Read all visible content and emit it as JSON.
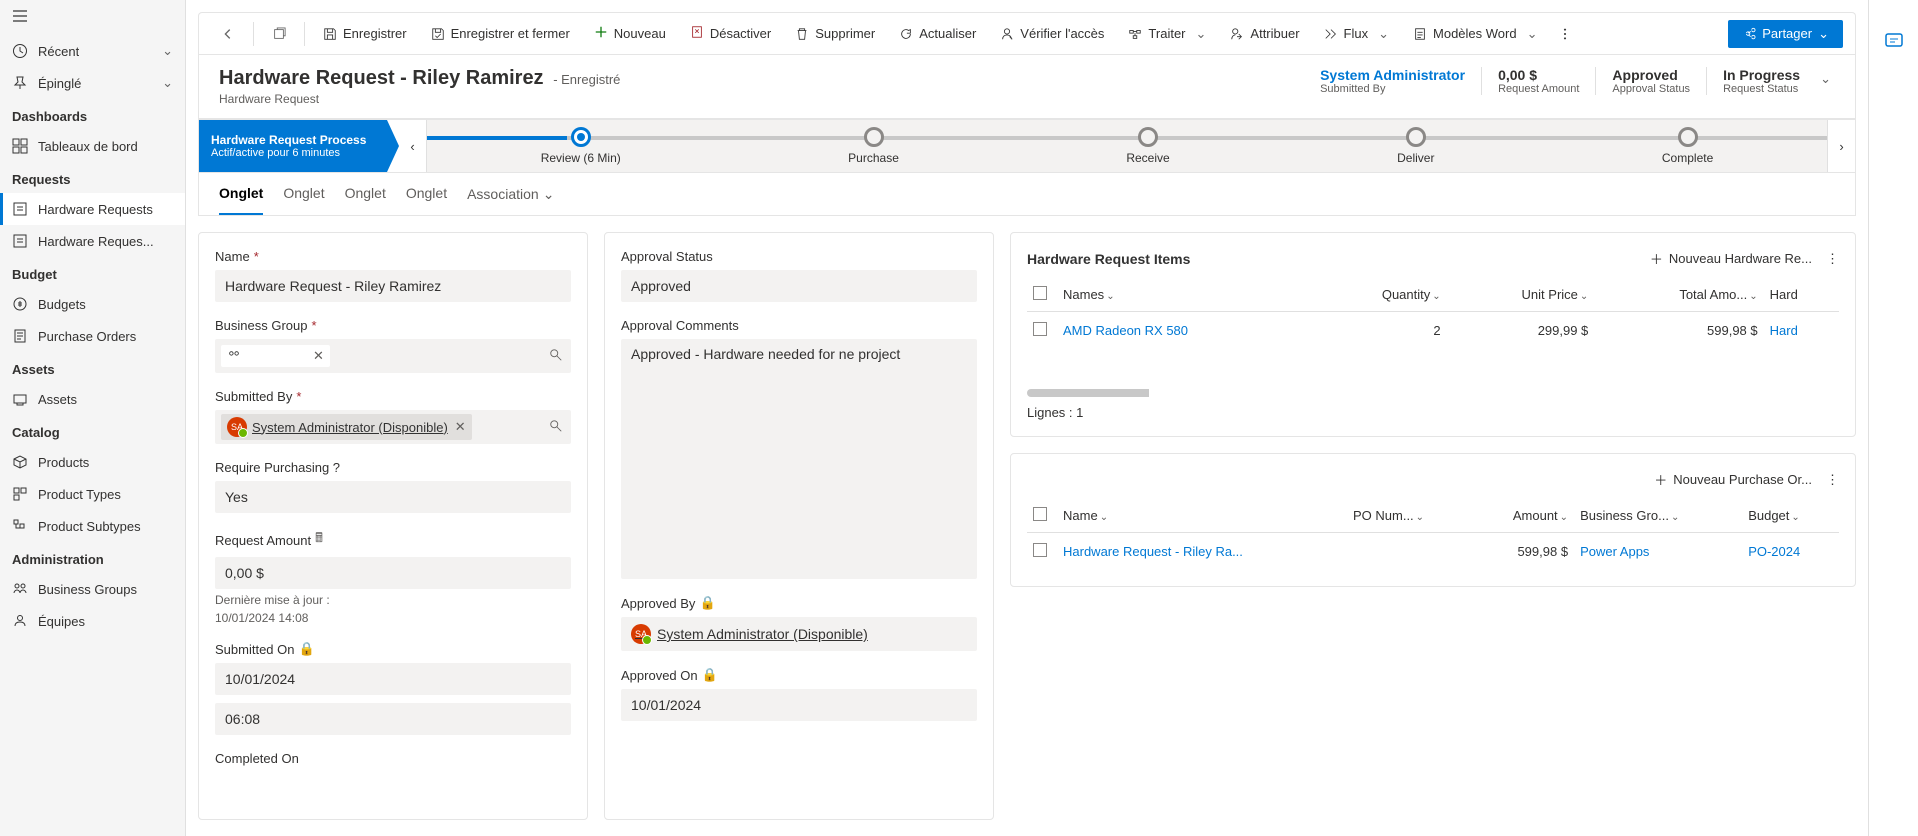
{
  "sidebar": {
    "recent": "Récent",
    "pinned": "Épinglé",
    "sections": {
      "dashboards": "Dashboards",
      "dash_item": "Tableaux de bord",
      "requests": "Requests",
      "req1": "Hardware Requests",
      "req2": "Hardware Reques...",
      "budget": "Budget",
      "budgets": "Budgets",
      "po": "Purchase Orders",
      "assets": "Assets",
      "assets_item": "Assets",
      "catalog": "Catalog",
      "products": "Products",
      "ptypes": "Product Types",
      "psubtypes": "Product Subtypes",
      "admin": "Administration",
      "bg": "Business Groups",
      "teams": "Équipes"
    }
  },
  "commands": {
    "save": "Enregistrer",
    "saveclose": "Enregistrer et fermer",
    "new": "Nouveau",
    "deactivate": "Désactiver",
    "delete": "Supprimer",
    "refresh": "Actualiser",
    "checkaccess": "Vérifier l'accès",
    "process": "Traiter",
    "assign": "Attribuer",
    "flow": "Flux",
    "wordtmpl": "Modèles Word",
    "share": "Partager"
  },
  "header": {
    "title": "Hardware Request - Riley Ramirez",
    "status": "- Enregistré",
    "subtitle": "Hardware Request",
    "fields": [
      {
        "val": "System Administrator",
        "lbl": "Submitted By",
        "link": true
      },
      {
        "val": "0,00 $",
        "lbl": "Request Amount"
      },
      {
        "val": "Approved",
        "lbl": "Approval Status"
      },
      {
        "val": "In Progress",
        "lbl": "Request Status"
      }
    ]
  },
  "bpf": {
    "title": "Hardware Request Process",
    "sub": "Actif/active pour 6 minutes",
    "stages": [
      "Review  (6 Min)",
      "Purchase",
      "Receive",
      "Deliver",
      "Complete"
    ]
  },
  "tabs": [
    "Onglet",
    "Onglet",
    "Onglet",
    "Onglet",
    "Association"
  ],
  "form": {
    "name_lbl": "Name",
    "name_val": "Hardware Request - Riley Ramirez",
    "bg_lbl": "Business Group",
    "subby_lbl": "Submitted By",
    "subby_val": "System Administrator (Disponible)",
    "reqpur_lbl": "Require Purchasing ?",
    "reqpur_val": "Yes",
    "amount_lbl": "Request Amount",
    "amount_val": "0,00 $",
    "amount_hint1": "Dernière mise à jour :",
    "amount_hint2": "10/01/2024 14:08",
    "subon_lbl": "Submitted On",
    "subon_date": "10/01/2024",
    "subon_time": "06:08",
    "compon_lbl": "Completed On",
    "appstat_lbl": "Approval Status",
    "appstat_val": "Approved",
    "appcom_lbl": "Approval Comments",
    "appcom_val": "Approved - Hardware needed for ne project",
    "appby_lbl": "Approved By",
    "appby_val": "System Administrator (Disponible)",
    "appon_lbl": "Approved On",
    "appon_val": "10/01/2024"
  },
  "subgrid1": {
    "title": "Hardware Request Items",
    "add": "Nouveau Hardware Re...",
    "cols": [
      "Names",
      "Quantity",
      "Unit Price",
      "Total Amo...",
      "Hard"
    ],
    "row": {
      "name": "AMD Radeon RX 580",
      "qty": "2",
      "price": "299,99 $",
      "total": "599,98 $",
      "hard": "Hard"
    },
    "footer": "Lignes : 1"
  },
  "subgrid2": {
    "add": "Nouveau Purchase Or...",
    "cols": [
      "Name",
      "PO Num...",
      "Amount",
      "Business Gro...",
      "Budget"
    ],
    "row": {
      "name": "Hardware Request - Riley Ra...",
      "po": "",
      "amount": "599,98 $",
      "bg": "Power Apps",
      "budget": "PO-2024"
    }
  }
}
